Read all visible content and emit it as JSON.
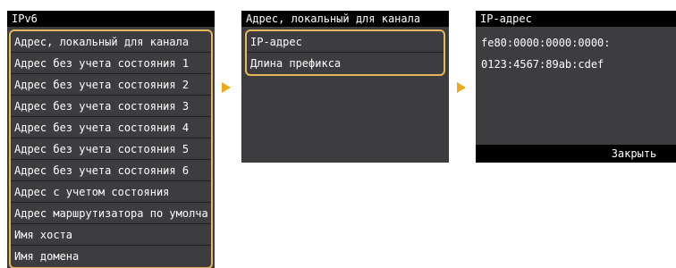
{
  "screen1": {
    "title": "IPv6",
    "items": [
      "Адрес, локальный для канала",
      "Адрес без учета состояния 1",
      "Адрес без учета состояния 2",
      "Адрес без учета состояния 3",
      "Адрес без учета состояния 4",
      "Адрес без учета состояния 5",
      "Адрес без учета состояния 6",
      "Адрес с учетом состояния",
      "Адрес маршрутизатора по умолча",
      "Имя хоста",
      "Имя домена"
    ]
  },
  "screen2": {
    "title": "Адрес, локальный для канала",
    "items": [
      "IP-адрес",
      "Длина префикса"
    ]
  },
  "screen3": {
    "title": "IP-адрес",
    "address_line1": "fe80:0000:0000:0000:",
    "address_line2": "0123:4567:89ab:cdef",
    "close_label": "Закрыть"
  },
  "colors": {
    "highlight": "#e6b85a",
    "arrow": "#f0a81d",
    "screen_bg": "#3d3d3f",
    "titlebar_bg": "#000000"
  },
  "icons": {
    "arrow": "right-triangle-arrow"
  }
}
